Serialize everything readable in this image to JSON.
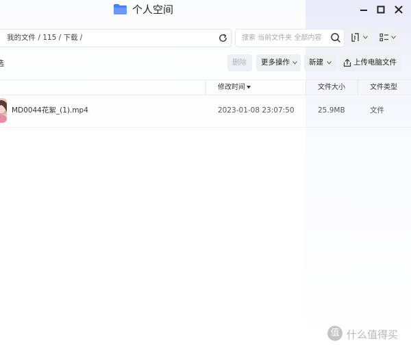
{
  "window": {
    "title": "个人空间",
    "folder_icon_color": "#4a7af5"
  },
  "breadcrumb": {
    "path": "我的文件 / 115 / 下载 /"
  },
  "search": {
    "placeholder": "搜索 当前文件夹 全部内容"
  },
  "toolbar": {
    "left_label_cut": "选",
    "delete_label": "删除",
    "more_label": "更多操作",
    "new_label": "新建",
    "upload_label": "上传电脑文件"
  },
  "table": {
    "columns": {
      "modified": "修改时间",
      "size": "文件大小",
      "type": "文件类型"
    },
    "rows": [
      {
        "name": "MD0044花絮_(1).mp4",
        "modified": "2023-01-08 23:07:50",
        "size": "25.9MB",
        "type": "文件"
      }
    ]
  },
  "watermark": {
    "logo_char": "值",
    "text": "什么值得买"
  },
  "icons": {
    "folder": "folder-icon",
    "refresh": "refresh-icon",
    "search": "search-icon",
    "view": "view-mode-icon",
    "sort": "list-sort-icon",
    "upload": "upload-icon",
    "minimize": "minimize-icon",
    "maximize": "maximize-icon",
    "close": "close-icon"
  },
  "colors": {
    "accent": "#4a7af5",
    "button_bg": "#eef0f4",
    "right_panel_tint": "#e8eaf8"
  }
}
